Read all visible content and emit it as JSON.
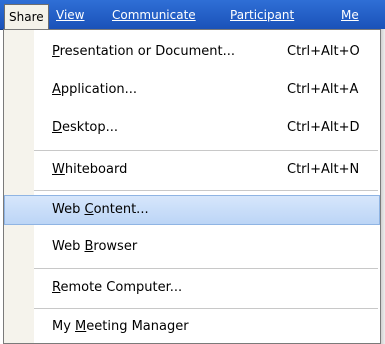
{
  "menubar": {
    "items": [
      {
        "label": "Share",
        "active": true
      },
      {
        "label": "View",
        "active": false
      },
      {
        "label": "Communicate",
        "active": false
      },
      {
        "label": "Participant",
        "active": false
      },
      {
        "label": "Me",
        "active": false
      }
    ]
  },
  "share_menu": {
    "items": [
      {
        "pre": "",
        "key": "P",
        "post": "resentation or Document...",
        "shortcut": "Ctrl+Alt+O"
      },
      {
        "pre": "",
        "key": "A",
        "post": "pplication...",
        "shortcut": "Ctrl+Alt+A"
      },
      {
        "pre": "",
        "key": "D",
        "post": "esktop...",
        "shortcut": "Ctrl+Alt+D"
      },
      {
        "pre": "",
        "key": "W",
        "post": "hiteboard",
        "shortcut": "Ctrl+Alt+N"
      },
      {
        "pre": "Web ",
        "key": "C",
        "post": "ontent...",
        "shortcut": ""
      },
      {
        "pre": "Web ",
        "key": "B",
        "post": "rowser",
        "shortcut": ""
      },
      {
        "pre": "",
        "key": "R",
        "post": "emote Computer...",
        "shortcut": ""
      },
      {
        "pre": "My ",
        "key": "M",
        "post": "eeting Manager",
        "shortcut": ""
      }
    ],
    "highlighted_index": 4
  },
  "colors": {
    "menubar_bg": "#1a52b8",
    "highlight_bg": "#bcd5f6",
    "gutter_bg": "#f5f3ec"
  }
}
